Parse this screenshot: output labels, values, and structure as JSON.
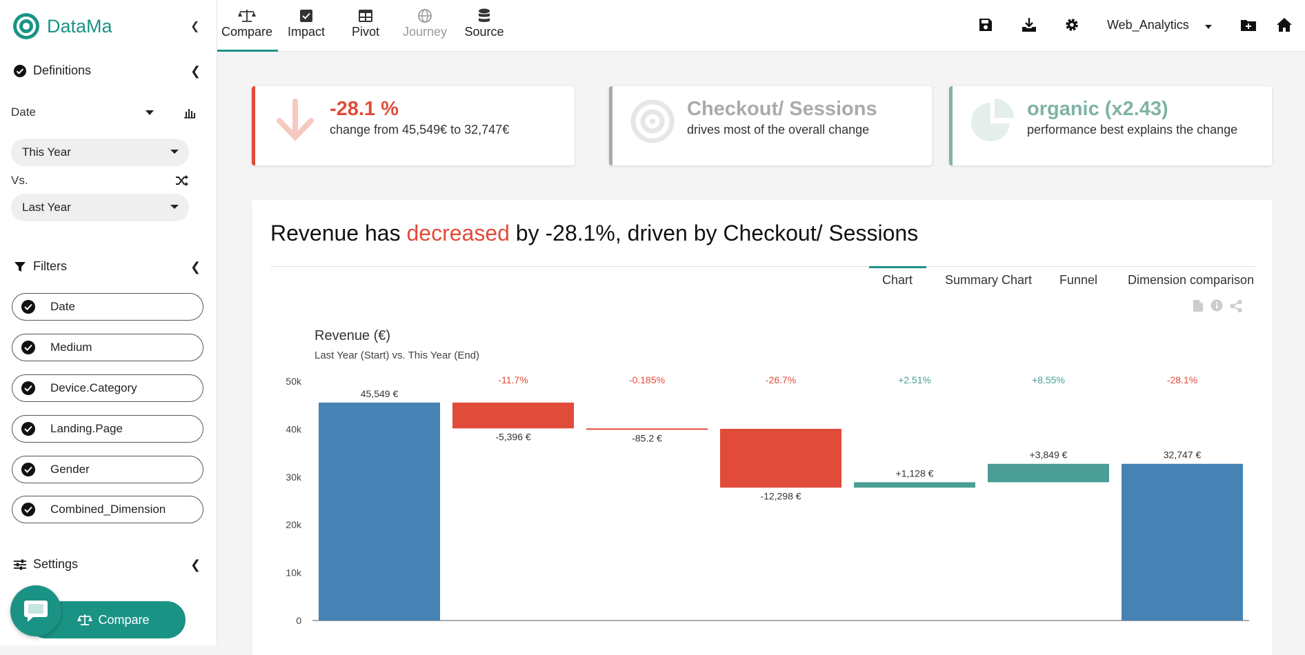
{
  "app": {
    "name": "DataMa"
  },
  "sidebar": {
    "definitions_label": "Definitions",
    "dimension_label": "Date",
    "period_value": "This Year",
    "vs_label": "Vs.",
    "compare_period_value": "Last Year",
    "filters_label": "Filters",
    "filters": [
      "Date",
      "Medium",
      "Device.Category",
      "Landing.Page",
      "Gender",
      "Combined_Dimension"
    ],
    "settings_label": "Settings",
    "compare_button": "Compare"
  },
  "nav": {
    "items": [
      {
        "label": "Compare",
        "icon": "balance-scale-icon",
        "active": true,
        "disabled": false
      },
      {
        "label": "Impact",
        "icon": "checkbox-icon",
        "active": false,
        "disabled": false
      },
      {
        "label": "Pivot",
        "icon": "table-icon",
        "active": false,
        "disabled": false
      },
      {
        "label": "Journey",
        "icon": "globe-icon",
        "active": false,
        "disabled": true
      },
      {
        "label": "Source",
        "icon": "database-icon",
        "active": false,
        "disabled": false
      }
    ],
    "dataset": "Web_Analytics"
  },
  "cards": [
    {
      "title": "-28.1 %",
      "subtitle": "change from 45,549€ to 32,747€",
      "color": "#e14b3a",
      "icon": "arrow-down-icon"
    },
    {
      "title": "Checkout/ Sessions",
      "subtitle": "drives most of the overall change",
      "color": "#aaaaaa",
      "icon": "target-icon"
    },
    {
      "title": "organic (x2.43)",
      "subtitle": "performance best explains the change",
      "color": "#7fb3a5",
      "icon": "pie-chart-icon"
    }
  ],
  "headline": {
    "prefix": "Revenue has ",
    "emphasis": "decreased",
    "suffix": " by -28.1%, driven by Checkout/ Sessions"
  },
  "tabs": [
    "Chart",
    "Summary Chart",
    "Funnel",
    "Dimension comparison"
  ],
  "colors": {
    "accent": "#1a9385",
    "negative": "#e14b3a",
    "positive": "#4a9e95",
    "total": "#4682b4"
  },
  "chart_data": {
    "type": "waterfall",
    "title": "Revenue (€)",
    "subtitle": "Last Year (Start) vs. This Year (End)",
    "ylim": [
      0,
      50000
    ],
    "yticks": [
      "0",
      "10k",
      "20k",
      "30k",
      "40k",
      "50k"
    ],
    "steps": [
      {
        "kind": "total",
        "value": 45549,
        "label": "45,549 €",
        "pct": ""
      },
      {
        "kind": "delta",
        "value": -5396,
        "label": "-5,396 €",
        "pct": "-11.7%"
      },
      {
        "kind": "delta",
        "value": -85.2,
        "label": "-85.2 €",
        "pct": "-0.185%"
      },
      {
        "kind": "delta",
        "value": -12298,
        "label": "-12,298 €",
        "pct": "-26.7%"
      },
      {
        "kind": "delta",
        "value": 1128,
        "label": "+1,128 €",
        "pct": "+2.51%"
      },
      {
        "kind": "delta",
        "value": 3849,
        "label": "+3,849 €",
        "pct": "+8.55%"
      },
      {
        "kind": "total",
        "value": 32747,
        "label": "32,747 €",
        "pct": "-28.1%"
      }
    ]
  }
}
